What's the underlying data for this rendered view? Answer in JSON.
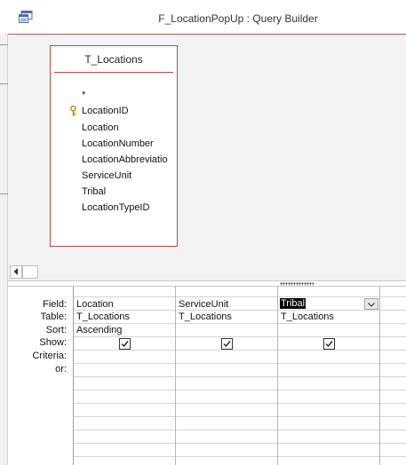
{
  "window": {
    "title": "F_LocationPopUp : Query Builder",
    "icon": "query-designer-icon"
  },
  "design": {
    "table": {
      "name": "T_Locations",
      "fields": [
        "*",
        "LocationID",
        "Location",
        "LocationNumber",
        "LocationAbbreviatio",
        "ServiceUnit",
        "Tribal",
        "LocationTypeID"
      ],
      "primary_key_field": "LocationID"
    },
    "accent_color": "#b34a4a"
  },
  "grid": {
    "row_labels": {
      "field": "Field:",
      "table": "Table:",
      "sort": "Sort:",
      "show": "Show:",
      "criteria": "Criteria:",
      "or": "or:"
    },
    "columns": [
      {
        "field": "Location",
        "table": "T_Locations",
        "sort": "Ascending",
        "show": true,
        "criteria": "",
        "or": ""
      },
      {
        "field": "ServiceUnit",
        "table": "T_Locations",
        "sort": "",
        "show": true,
        "criteria": "",
        "or": ""
      },
      {
        "field": "Tribal",
        "table": "T_Locations",
        "sort": "",
        "show": true,
        "criteria": "",
        "or": "",
        "selected": true
      }
    ]
  }
}
